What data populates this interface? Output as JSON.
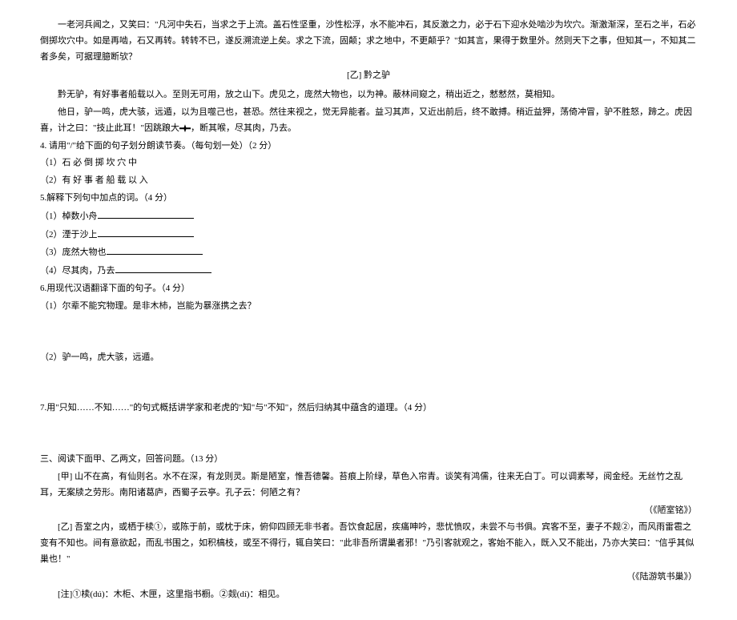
{
  "p1": "一老河兵闻之，又笑曰：\"凡河中失石，当求之于上流。盖石性坚重，沙性松浮，水不能冲石，其反激之力，必于石下迎水处啮沙为坎穴。渐激渐深，至石之半，石必倒掷坎穴中。如是再啮，石又再转。转转不已，遂反溯流逆上矣。求之下流，固颠；求之地中，不更颠乎？\"如其言，果得于数里外。然则天下之事，但知其一，不知其二者多矣，可据理臆断欤？",
  "titleYi": "[乙] 黔之驴",
  "p2": "黔无驴，有好事者船载以入。至则无可用，放之山下。虎见之，庞然大物也，以为神。蔽林间窥之，稍出近之，慭慭然，莫相知。",
  "p3_a": "他日，驴一鸣，虎大骇，远遁，以为且噬己也，甚恐。然往来视之，觉无异能者。益习其声，又近出前后，终不敢搏。稍近益狎，荡倚冲冒，驴不胜怒，蹄之。虎因喜，计之曰：\"技止此耳！\"因跳踉大",
  "p3_b": "，断其喉，尽其肉，乃去。",
  "q4": "4. 请用\"/\"给下面的句子划分朗读节奏。（每句划一处）（2 分）",
  "q4_1": "（1）石 必 倒 掷 坎 穴 中",
  "q4_2": "（2）有 好 事 者 船 载 以 入",
  "q5": "5.解释下列句中加点的词。（4 分）",
  "q5_1": "（1）棹数小舟",
  "q5_2": "（2）湮于沙上",
  "q5_3": "（3）庞然大物也",
  "q5_4": "（4）尽其肉，乃去",
  "q6": "6.用现代汉语翻译下面的句子。（4 分）",
  "q6_1": "（1）尔辈不能究物理。是非木杮，岂能为暴涨携之去？",
  "q6_2": "（2）驴一鸣，虎大骇，远遁。",
  "q7": "7.用\"只知……不知……\"的句式概括讲学家和老虎的\"知\"与\"不知\"，然后归纳其中蕴含的道理。（4 分）",
  "section3": "三、阅读下面甲、乙两文，回答问题。（13 分）",
  "jia": "[甲] 山不在高，有仙则名。水不在深，有龙则灵。斯是陋室，惟吾德馨。苔痕上阶绿，草色入帘青。谈笑有鸿儒，往来无白丁。可以调素琴，阅金经。无丝竹之乱耳，无案牍之劳形。南阳诸葛庐，西蜀子云亭。孔子云：何陋之有？",
  "src1": "（《陋室铭》）",
  "yi": "[乙] 吾室之内，或栖于椟①，或陈于前，或枕于床，俯仰四顾无非书者。吾饮食起居，疾痛呻吟，悲忧愤叹，未尝不与书俱。宾客不至，妻子不觌②，而风雨雷雹之变有不知也。间有意欲起，而乱书围之，如积槁枝，或至不得行，辄自笑曰：\"此非吾所谓巢者邪！\"乃引客就观之，客始不能入，既入又不能出，乃亦大笑曰：\"信乎其似巢也！\"",
  "src2": "（《陆游筑书巢》）",
  "note": "[注]①椟(dú)：木柜、木匣，这里指书橱。②觌(dí)：相见。"
}
